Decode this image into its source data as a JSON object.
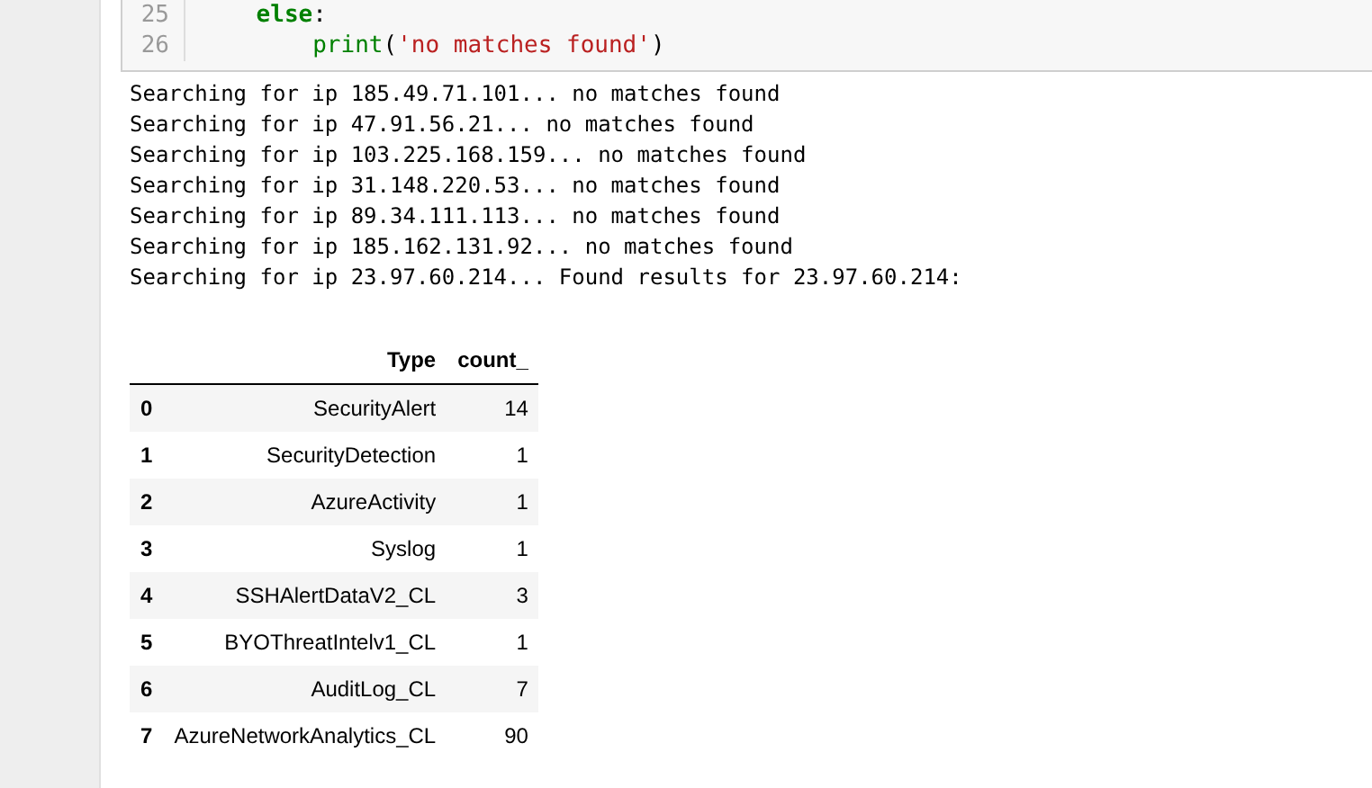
{
  "code_cell": {
    "lines": [
      {
        "number": "25",
        "tokens": [
          {
            "kind": "keyword",
            "text": "else"
          },
          {
            "kind": "plain",
            "text": ":"
          }
        ],
        "children": [
          {
            "number": "26",
            "tokens": [
              {
                "kind": "builtin",
                "text": "print"
              },
              {
                "kind": "plain",
                "text": "("
              },
              {
                "kind": "string",
                "text": "'no matches found'"
              },
              {
                "kind": "plain",
                "text": ")"
              }
            ]
          }
        ]
      }
    ]
  },
  "output": {
    "lines": [
      "Searching for ip 185.49.71.101... no matches found",
      "Searching for ip 47.91.56.21... no matches found",
      "Searching for ip 103.225.168.159... no matches found",
      "Searching for ip 31.148.220.53... no matches found",
      "Searching for ip 89.34.111.113... no matches found",
      "Searching for ip 185.162.131.92... no matches found",
      "Searching for ip 23.97.60.214... Found results for 23.97.60.214:"
    ],
    "table": {
      "columns": [
        "Type",
        "count_"
      ],
      "rows": [
        {
          "index": "0",
          "type": "SecurityAlert",
          "count": "14"
        },
        {
          "index": "1",
          "type": "SecurityDetection",
          "count": "1"
        },
        {
          "index": "2",
          "type": "AzureActivity",
          "count": "1"
        },
        {
          "index": "3",
          "type": "Syslog",
          "count": "1"
        },
        {
          "index": "4",
          "type": "SSHAlertDataV2_CL",
          "count": "3"
        },
        {
          "index": "5",
          "type": "BYOThreatIntelv1_CL",
          "count": "1"
        },
        {
          "index": "6",
          "type": "AuditLog_CL",
          "count": "7"
        },
        {
          "index": "7",
          "type": "AzureNetworkAnalytics_CL",
          "count": "90"
        }
      ]
    }
  }
}
